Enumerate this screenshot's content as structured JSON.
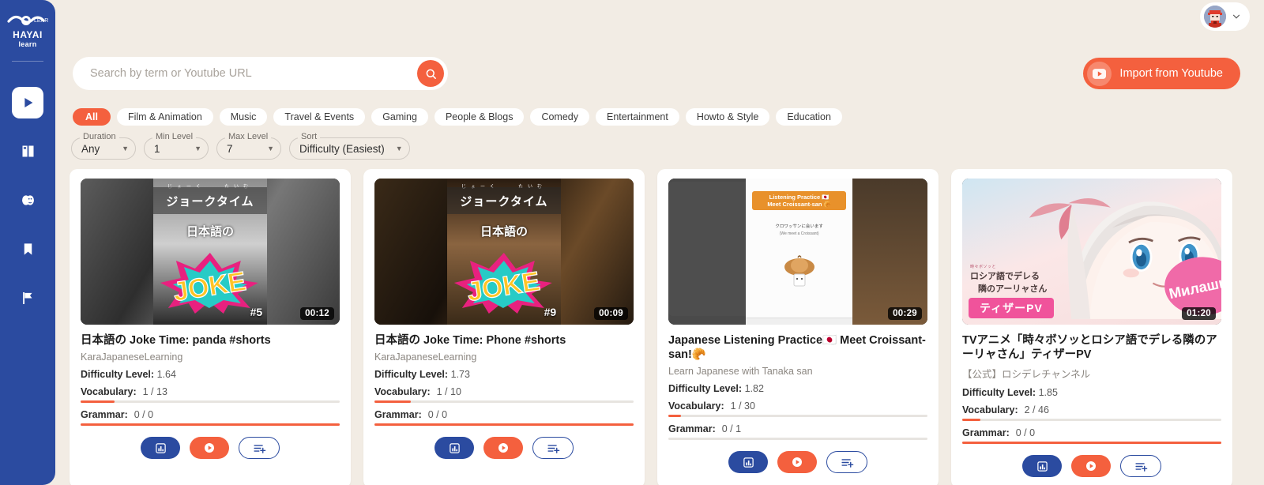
{
  "brand": {
    "name": "HAYAI",
    "sub": "learn",
    "color": "#2b4ba0",
    "accent": "#f4603e"
  },
  "sidebar": {
    "items": [
      {
        "name": "videos",
        "icon": "play-icon",
        "active": true
      },
      {
        "name": "book",
        "icon": "book-icon",
        "active": false
      },
      {
        "name": "drama",
        "icon": "theater-masks-icon",
        "active": false
      },
      {
        "name": "saved",
        "icon": "bookmark-icon",
        "active": false
      },
      {
        "name": "goals",
        "icon": "flag-icon",
        "active": false
      }
    ]
  },
  "topbar": {
    "avatar_icon": "user-avatar",
    "chevron_icon": "chevron-down-icon"
  },
  "search": {
    "placeholder": "Search by term or Youtube URL",
    "value": "",
    "button_icon": "search-icon"
  },
  "import": {
    "label": "Import from Youtube",
    "icon": "youtube-icon"
  },
  "categories": [
    {
      "label": "All",
      "active": true
    },
    {
      "label": "Film & Animation",
      "active": false
    },
    {
      "label": "Music",
      "active": false
    },
    {
      "label": "Travel & Events",
      "active": false
    },
    {
      "label": "Gaming",
      "active": false
    },
    {
      "label": "People & Blogs",
      "active": false
    },
    {
      "label": "Comedy",
      "active": false
    },
    {
      "label": "Entertainment",
      "active": false
    },
    {
      "label": "Howto & Style",
      "active": false
    },
    {
      "label": "Education",
      "active": false
    }
  ],
  "filters": [
    {
      "label": "Duration",
      "value": "Any"
    },
    {
      "label": "Min Level",
      "value": "1"
    },
    {
      "label": "Max Level",
      "value": "7"
    },
    {
      "label": "Sort",
      "value": "Difficulty (Easiest)"
    }
  ],
  "labels": {
    "difficulty": "Difficulty Level:",
    "vocabulary": "Vocabulary:",
    "grammar": "Grammar:"
  },
  "cards": [
    {
      "title": "日本語の Joke Time: panda #shorts",
      "channel": "KaraJapaneseLearning",
      "difficulty": "1.64",
      "vocabulary": "1 / 13",
      "vocab_pct": 13,
      "grammar": "0 / 0",
      "grammar_pct": 100,
      "duration": "00:12",
      "thumb": {
        "band": "ジョークタイム",
        "ruby": "じょーく　　たいむ",
        "nihongo": "日本語の",
        "burst": "JOKE",
        "num": "#5",
        "kind": "panda"
      }
    },
    {
      "title": "日本語の Joke Time: Phone #shorts",
      "channel": "KaraJapaneseLearning",
      "difficulty": "1.73",
      "vocabulary": "1 / 10",
      "vocab_pct": 14,
      "grammar": "0 / 0",
      "grammar_pct": 100,
      "duration": "00:09",
      "thumb": {
        "band": "ジョークタイム",
        "ruby": "じょーく　　たいむ",
        "nihongo": "日本語の",
        "burst": "JOKE",
        "num": "#9",
        "kind": "phone"
      }
    },
    {
      "title": "Japanese Listening Practice🇯🇵 Meet Croissant-san!🥐",
      "channel": "Learn Japanese with Tanaka san",
      "difficulty": "1.82",
      "vocabulary": "1 / 30",
      "vocab_pct": 5,
      "grammar": "0 / 1",
      "grammar_pct": 0,
      "duration": "00:29",
      "thumb": {
        "banner_line1": "Listening Practice 🇯🇵",
        "banner_line2": "Meet Croissant-san 🥐",
        "sub_line1": "クロワッサンに会います",
        "sub_line2": "(We meet a Croissant)",
        "kind": "croissant"
      }
    },
    {
      "title": "TVアニメ「時々ボソッとロシア語でデレる隣のアーリャさん」ティザーPV",
      "channel": "【公式】ロシデレチャンネル",
      "difficulty": "1.85",
      "vocabulary": "2 / 46",
      "vocab_pct": 7,
      "grammar": "0 / 0",
      "grammar_pct": 100,
      "duration": "01:20",
      "thumb": {
        "jp_small": "時々ボソッと",
        "jp_line1": "ロシア語でデレる",
        "jp_line2": "隣のアーリャさん",
        "badge": "ティザーPV",
        "bubble": "Милашка",
        "kind": "anime"
      }
    }
  ],
  "card_actions": {
    "stats_icon": "bar-chart-icon",
    "play_icon": "play-icon",
    "add_icon": "add-to-list-icon"
  }
}
